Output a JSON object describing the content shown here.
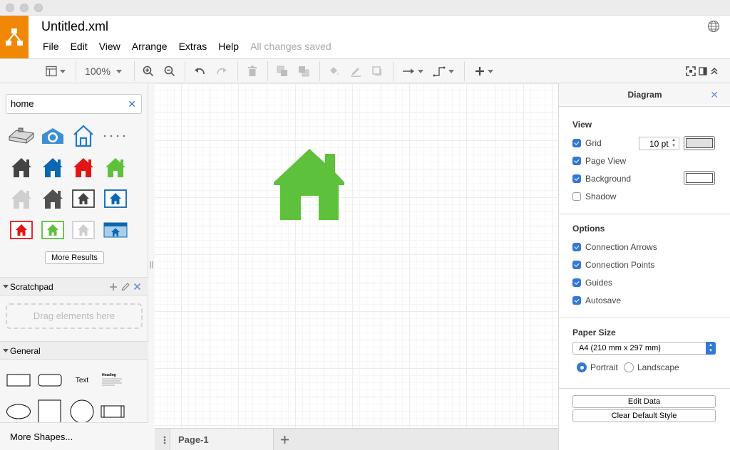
{
  "app": {
    "brand_color": "#f08705"
  },
  "header": {
    "title": "Untitled.xml",
    "menus": [
      "File",
      "Edit",
      "View",
      "Arrange",
      "Extras",
      "Help"
    ],
    "status": "All changes saved"
  },
  "toolbar": {
    "zoom": "100%"
  },
  "sidebar": {
    "search": {
      "value": "home",
      "placeholder": ""
    },
    "more_results_label": "More Results",
    "scratchpad": {
      "title": "Scratchpad",
      "drag_hint": "Drag elements here"
    },
    "general": {
      "title": "General",
      "text_shape_label": "Text",
      "heading_shape_label": "Heading"
    },
    "more_shapes_label": "More Shapes..."
  },
  "canvas": {
    "house_color": "#5ec13b"
  },
  "pages": {
    "tab_label": "Page-1"
  },
  "format_panel": {
    "title": "Diagram",
    "view": {
      "title": "View",
      "grid_label": "Grid",
      "grid_checked": true,
      "grid_size": "10 pt",
      "page_view_label": "Page View",
      "page_view_checked": true,
      "background_label": "Background",
      "background_checked": true,
      "shadow_label": "Shadow",
      "shadow_checked": false
    },
    "options": {
      "title": "Options",
      "items": [
        {
          "label": "Connection Arrows",
          "checked": true
        },
        {
          "label": "Connection Points",
          "checked": true
        },
        {
          "label": "Guides",
          "checked": true
        },
        {
          "label": "Autosave",
          "checked": true
        }
      ]
    },
    "paper": {
      "title": "Paper Size",
      "size": "A4 (210 mm x 297 mm)",
      "portrait_label": "Portrait",
      "landscape_label": "Landscape",
      "orientation": "Portrait"
    },
    "buttons": {
      "edit_data": "Edit Data",
      "clear_style": "Clear Default Style"
    }
  }
}
